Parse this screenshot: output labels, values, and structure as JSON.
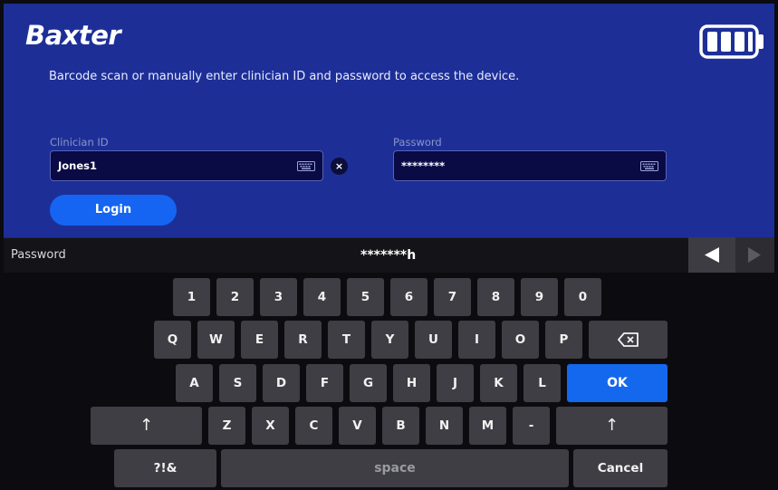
{
  "brand": "Baxter",
  "instructions": "Barcode scan or manually enter clinician ID and password to access the device.",
  "form": {
    "clinician_label": "Clinician ID",
    "clinician_value": "Jones1",
    "clear_label": "×",
    "password_label": "Password",
    "password_value": "********",
    "login_label": "Login"
  },
  "entry": {
    "label": "Password",
    "value": "*******h"
  },
  "keyboard": {
    "rows": [
      [
        "1",
        "2",
        "3",
        "4",
        "5",
        "6",
        "7",
        "8",
        "9",
        "0"
      ],
      [
        "Q",
        "W",
        "E",
        "R",
        "T",
        "Y",
        "U",
        "I",
        "O",
        "P"
      ],
      [
        "A",
        "S",
        "D",
        "F",
        "G",
        "H",
        "J",
        "K",
        "L"
      ],
      [
        "Z",
        "X",
        "C",
        "V",
        "B",
        "N",
        "M",
        "-"
      ]
    ],
    "ok": "OK",
    "shift": "↑",
    "backspace": "⌫",
    "symbols": "?!&",
    "space": "space",
    "cancel": "Cancel"
  },
  "icons": {
    "battery": "battery-full-icon",
    "keyboard": "keyboard-icon",
    "left": "arrow-left-icon",
    "right": "arrow-right-icon"
  },
  "colors": {
    "header_bg": "#1d2f97",
    "field_bg": "#0a0a45",
    "accent": "#1565f2",
    "key_bg": "#3e3e44"
  }
}
